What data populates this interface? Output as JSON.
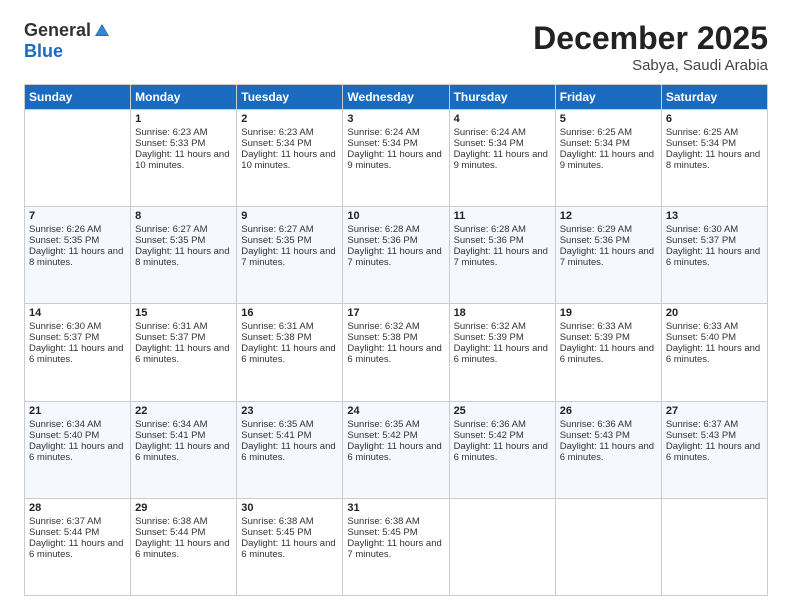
{
  "logo": {
    "general": "General",
    "blue": "Blue"
  },
  "title": "December 2025",
  "location": "Sabya, Saudi Arabia",
  "days_of_week": [
    "Sunday",
    "Monday",
    "Tuesday",
    "Wednesday",
    "Thursday",
    "Friday",
    "Saturday"
  ],
  "weeks": [
    [
      {
        "day": "",
        "sunrise": "",
        "sunset": "",
        "daylight": ""
      },
      {
        "day": "1",
        "sunrise": "Sunrise: 6:23 AM",
        "sunset": "Sunset: 5:33 PM",
        "daylight": "Daylight: 11 hours and 10 minutes."
      },
      {
        "day": "2",
        "sunrise": "Sunrise: 6:23 AM",
        "sunset": "Sunset: 5:34 PM",
        "daylight": "Daylight: 11 hours and 10 minutes."
      },
      {
        "day": "3",
        "sunrise": "Sunrise: 6:24 AM",
        "sunset": "Sunset: 5:34 PM",
        "daylight": "Daylight: 11 hours and 9 minutes."
      },
      {
        "day": "4",
        "sunrise": "Sunrise: 6:24 AM",
        "sunset": "Sunset: 5:34 PM",
        "daylight": "Daylight: 11 hours and 9 minutes."
      },
      {
        "day": "5",
        "sunrise": "Sunrise: 6:25 AM",
        "sunset": "Sunset: 5:34 PM",
        "daylight": "Daylight: 11 hours and 9 minutes."
      },
      {
        "day": "6",
        "sunrise": "Sunrise: 6:25 AM",
        "sunset": "Sunset: 5:34 PM",
        "daylight": "Daylight: 11 hours and 8 minutes."
      }
    ],
    [
      {
        "day": "7",
        "sunrise": "Sunrise: 6:26 AM",
        "sunset": "Sunset: 5:35 PM",
        "daylight": "Daylight: 11 hours and 8 minutes."
      },
      {
        "day": "8",
        "sunrise": "Sunrise: 6:27 AM",
        "sunset": "Sunset: 5:35 PM",
        "daylight": "Daylight: 11 hours and 8 minutes."
      },
      {
        "day": "9",
        "sunrise": "Sunrise: 6:27 AM",
        "sunset": "Sunset: 5:35 PM",
        "daylight": "Daylight: 11 hours and 7 minutes."
      },
      {
        "day": "10",
        "sunrise": "Sunrise: 6:28 AM",
        "sunset": "Sunset: 5:36 PM",
        "daylight": "Daylight: 11 hours and 7 minutes."
      },
      {
        "day": "11",
        "sunrise": "Sunrise: 6:28 AM",
        "sunset": "Sunset: 5:36 PM",
        "daylight": "Daylight: 11 hours and 7 minutes."
      },
      {
        "day": "12",
        "sunrise": "Sunrise: 6:29 AM",
        "sunset": "Sunset: 5:36 PM",
        "daylight": "Daylight: 11 hours and 7 minutes."
      },
      {
        "day": "13",
        "sunrise": "Sunrise: 6:30 AM",
        "sunset": "Sunset: 5:37 PM",
        "daylight": "Daylight: 11 hours and 6 minutes."
      }
    ],
    [
      {
        "day": "14",
        "sunrise": "Sunrise: 6:30 AM",
        "sunset": "Sunset: 5:37 PM",
        "daylight": "Daylight: 11 hours and 6 minutes."
      },
      {
        "day": "15",
        "sunrise": "Sunrise: 6:31 AM",
        "sunset": "Sunset: 5:37 PM",
        "daylight": "Daylight: 11 hours and 6 minutes."
      },
      {
        "day": "16",
        "sunrise": "Sunrise: 6:31 AM",
        "sunset": "Sunset: 5:38 PM",
        "daylight": "Daylight: 11 hours and 6 minutes."
      },
      {
        "day": "17",
        "sunrise": "Sunrise: 6:32 AM",
        "sunset": "Sunset: 5:38 PM",
        "daylight": "Daylight: 11 hours and 6 minutes."
      },
      {
        "day": "18",
        "sunrise": "Sunrise: 6:32 AM",
        "sunset": "Sunset: 5:39 PM",
        "daylight": "Daylight: 11 hours and 6 minutes."
      },
      {
        "day": "19",
        "sunrise": "Sunrise: 6:33 AM",
        "sunset": "Sunset: 5:39 PM",
        "daylight": "Daylight: 11 hours and 6 minutes."
      },
      {
        "day": "20",
        "sunrise": "Sunrise: 6:33 AM",
        "sunset": "Sunset: 5:40 PM",
        "daylight": "Daylight: 11 hours and 6 minutes."
      }
    ],
    [
      {
        "day": "21",
        "sunrise": "Sunrise: 6:34 AM",
        "sunset": "Sunset: 5:40 PM",
        "daylight": "Daylight: 11 hours and 6 minutes."
      },
      {
        "day": "22",
        "sunrise": "Sunrise: 6:34 AM",
        "sunset": "Sunset: 5:41 PM",
        "daylight": "Daylight: 11 hours and 6 minutes."
      },
      {
        "day": "23",
        "sunrise": "Sunrise: 6:35 AM",
        "sunset": "Sunset: 5:41 PM",
        "daylight": "Daylight: 11 hours and 6 minutes."
      },
      {
        "day": "24",
        "sunrise": "Sunrise: 6:35 AM",
        "sunset": "Sunset: 5:42 PM",
        "daylight": "Daylight: 11 hours and 6 minutes."
      },
      {
        "day": "25",
        "sunrise": "Sunrise: 6:36 AM",
        "sunset": "Sunset: 5:42 PM",
        "daylight": "Daylight: 11 hours and 6 minutes."
      },
      {
        "day": "26",
        "sunrise": "Sunrise: 6:36 AM",
        "sunset": "Sunset: 5:43 PM",
        "daylight": "Daylight: 11 hours and 6 minutes."
      },
      {
        "day": "27",
        "sunrise": "Sunrise: 6:37 AM",
        "sunset": "Sunset: 5:43 PM",
        "daylight": "Daylight: 11 hours and 6 minutes."
      }
    ],
    [
      {
        "day": "28",
        "sunrise": "Sunrise: 6:37 AM",
        "sunset": "Sunset: 5:44 PM",
        "daylight": "Daylight: 11 hours and 6 minutes."
      },
      {
        "day": "29",
        "sunrise": "Sunrise: 6:38 AM",
        "sunset": "Sunset: 5:44 PM",
        "daylight": "Daylight: 11 hours and 6 minutes."
      },
      {
        "day": "30",
        "sunrise": "Sunrise: 6:38 AM",
        "sunset": "Sunset: 5:45 PM",
        "daylight": "Daylight: 11 hours and 6 minutes."
      },
      {
        "day": "31",
        "sunrise": "Sunrise: 6:38 AM",
        "sunset": "Sunset: 5:45 PM",
        "daylight": "Daylight: 11 hours and 7 minutes."
      },
      {
        "day": "",
        "sunrise": "",
        "sunset": "",
        "daylight": ""
      },
      {
        "day": "",
        "sunrise": "",
        "sunset": "",
        "daylight": ""
      },
      {
        "day": "",
        "sunrise": "",
        "sunset": "",
        "daylight": ""
      }
    ]
  ]
}
